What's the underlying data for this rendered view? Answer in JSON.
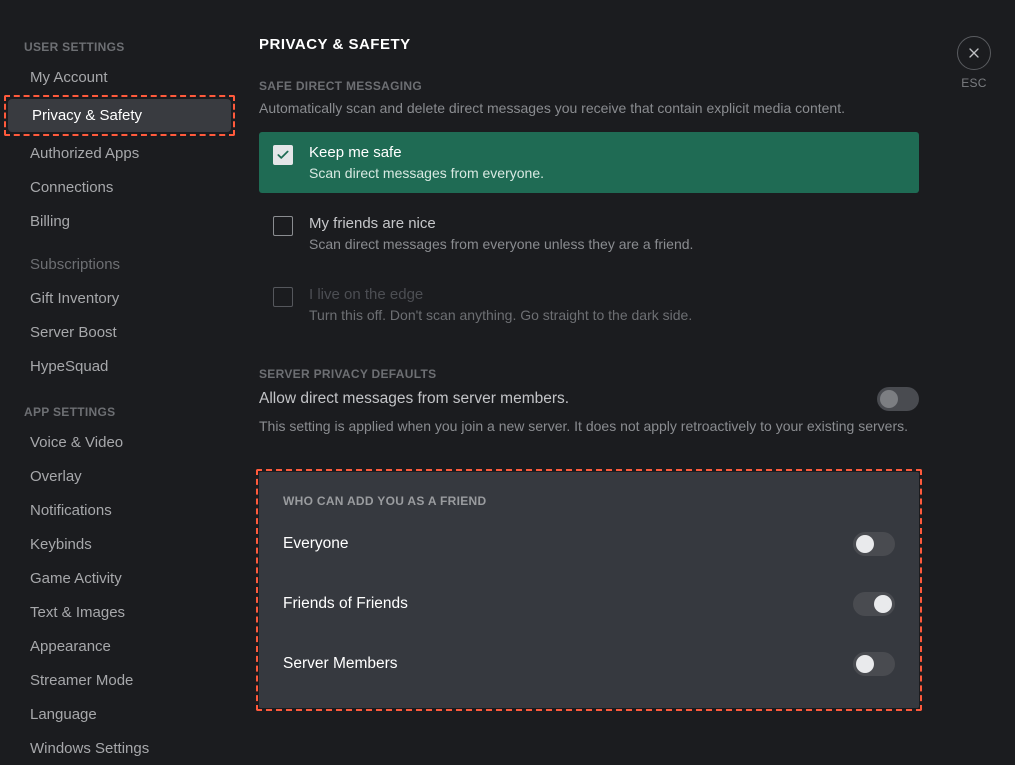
{
  "close": {
    "esc": "ESC"
  },
  "sidebar": {
    "sections": {
      "user": {
        "header": "USER SETTINGS",
        "items": [
          "My Account",
          "Privacy & Safety",
          "Authorized Apps",
          "Connections",
          "Billing",
          "Subscriptions",
          "Gift Inventory",
          "Server Boost",
          "HypeSquad"
        ]
      },
      "app": {
        "header": "APP SETTINGS",
        "items": [
          "Voice & Video",
          "Overlay",
          "Notifications",
          "Keybinds",
          "Game Activity",
          "Text & Images",
          "Appearance",
          "Streamer Mode",
          "Language",
          "Windows Settings"
        ]
      }
    }
  },
  "page": {
    "title": "PRIVACY & SAFETY",
    "safe_dm": {
      "header": "SAFE DIRECT MESSAGING",
      "desc": "Automatically scan and delete direct messages you receive that contain explicit media content.",
      "options": [
        {
          "title": "Keep me safe",
          "sub": "Scan direct messages from everyone."
        },
        {
          "title": "My friends are nice",
          "sub": "Scan direct messages from everyone unless they are a friend."
        },
        {
          "title": "I live on the edge",
          "sub": "Turn this off. Don't scan anything. Go straight to the dark side."
        }
      ]
    },
    "server_privacy": {
      "header": "SERVER PRIVACY DEFAULTS",
      "label": "Allow direct messages from server members.",
      "desc": "This setting is applied when you join a new server. It does not apply retroactively to your existing servers."
    },
    "friend_add": {
      "header": "WHO CAN ADD YOU AS A FRIEND",
      "rows": [
        {
          "label": "Everyone"
        },
        {
          "label": "Friends of Friends"
        },
        {
          "label": "Server Members"
        }
      ]
    }
  }
}
